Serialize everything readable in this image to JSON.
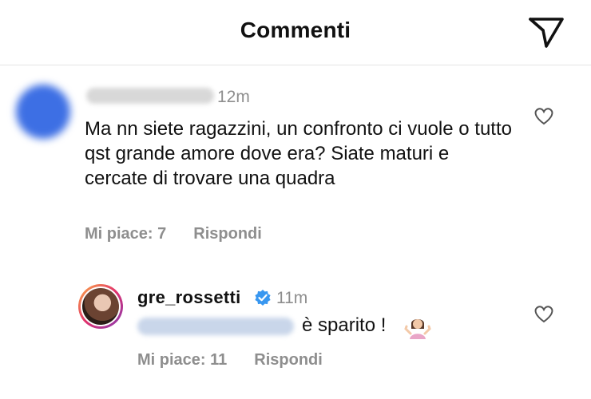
{
  "header": {
    "title": "Commenti",
    "send_icon": "paper-plane-icon"
  },
  "comments": [
    {
      "timestamp": "12m",
      "text": "Ma nn siete ragazzini, un confronto ci vuole o tutto qst grande amore dove era? Siate maturi e cercate di trovare una quadra",
      "likes_label": "Mi piace: 7",
      "reply_label": "Rispondi",
      "like_icon": "heart-outline-icon"
    },
    {
      "username": "gre_rossetti",
      "verified": true,
      "timestamp": "11m",
      "text": "è sparito !",
      "emoji": "woman-shrugging-emoji",
      "likes_label": "Mi piace: 11",
      "reply_label": "Rispondi",
      "like_icon": "heart-outline-icon"
    }
  ],
  "colors": {
    "verified_badge": "#3897f0",
    "muted_text": "#8e8e8e",
    "ring_start": "#fcaf45",
    "ring_end": "#833ab4"
  }
}
